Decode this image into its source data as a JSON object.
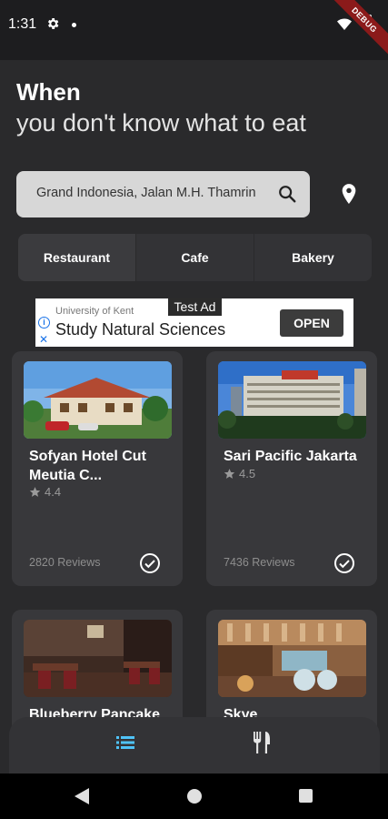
{
  "status_bar": {
    "time": "1:31",
    "debug_label": "DEBUG"
  },
  "header": {
    "title": "When",
    "subtitle": "you don't know what to eat"
  },
  "search": {
    "value": "Grand Indonesia, Jalan M.H. Thamrin"
  },
  "tabs": [
    {
      "label": "Restaurant",
      "active": true
    },
    {
      "label": "Cafe",
      "active": false
    },
    {
      "label": "Bakery",
      "active": false
    }
  ],
  "ad": {
    "badge": "Test Ad",
    "sponsor": "University of Kent",
    "headline": "Study Natural Sciences",
    "cta": "OPEN"
  },
  "places": [
    {
      "name": "Sofyan Hotel Cut Meutia C...",
      "rating": "4.4",
      "reviews": "2820 Reviews"
    },
    {
      "name": "Sari Pacific Jakarta",
      "rating": "4.5",
      "reviews": "7436 Reviews"
    },
    {
      "name": "Blueberry Pancake",
      "rating": "",
      "reviews": ""
    },
    {
      "name": "Skye",
      "rating": "",
      "reviews": ""
    }
  ],
  "colors": {
    "background": "#2a2a2c",
    "card": "#38383b",
    "accent": "#4fc3f7"
  }
}
